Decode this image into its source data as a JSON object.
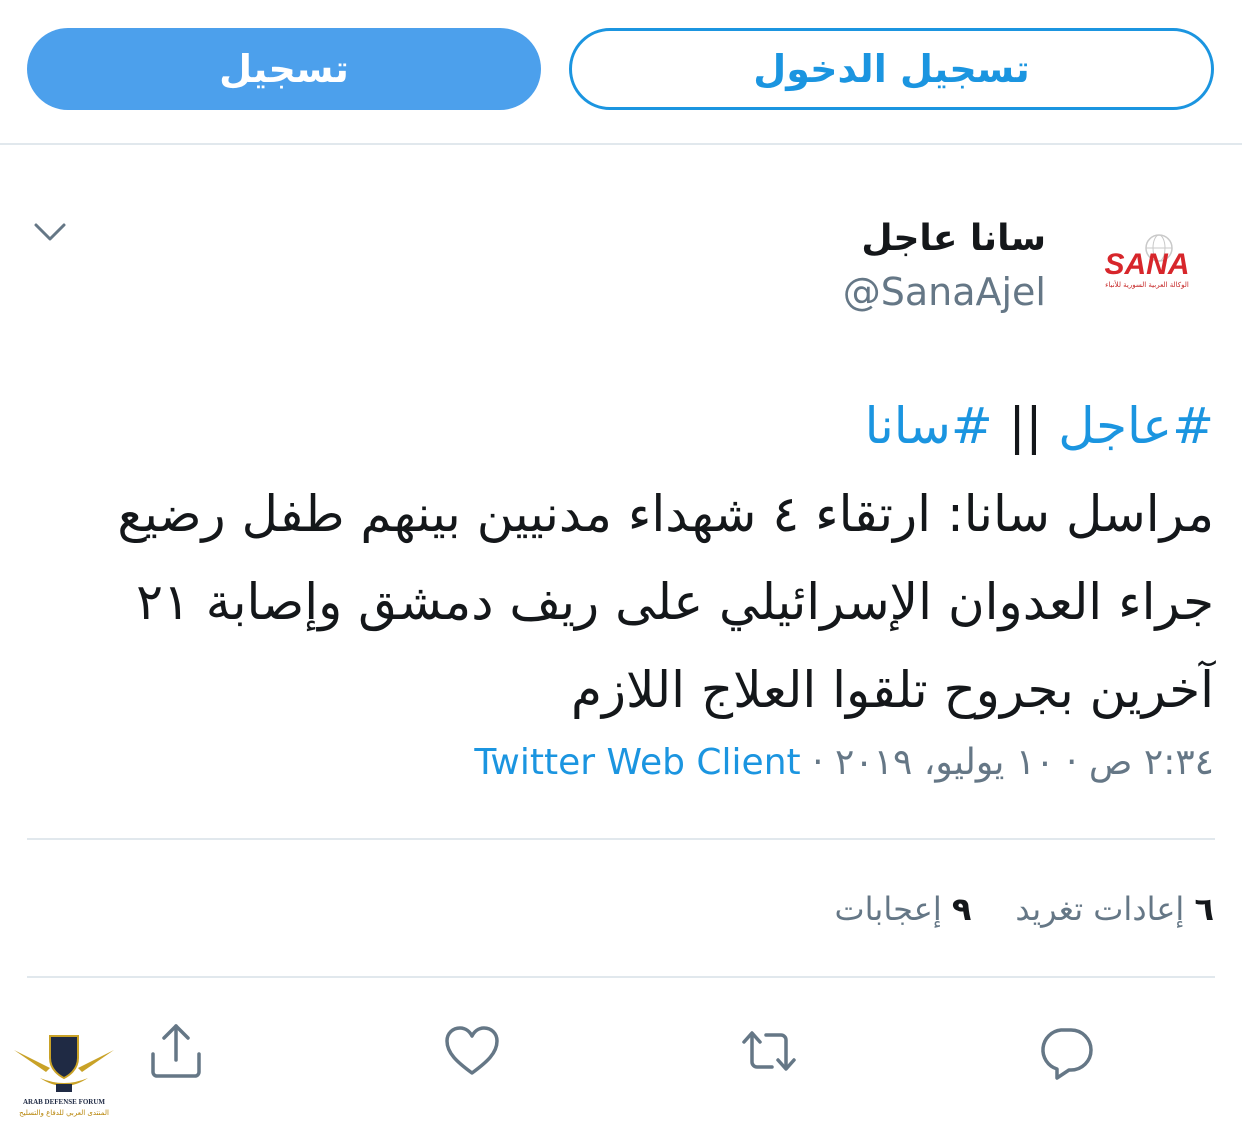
{
  "auth": {
    "signup_label": "تسجيل",
    "login_label": "تسجيل الدخول"
  },
  "tweet": {
    "display_name": "سانا عاجل",
    "handle": "@SanaAjel",
    "avatar_text": "SANA",
    "avatar_subtext": "الوكالة العربية السورية للأنباء",
    "hashtag_1": "#عاجل",
    "separator": " || ",
    "hashtag_2": "#سانا",
    "body": "مراسل سانا: ارتقاء ٤ شهداء مدنيين بينهم طفل رضيع جراء العدوان الإسرائيلي على ريف دمشق وإصابة ٢١ آخرين بجروح تلقوا العلاج اللازم",
    "timestamp": "٢:٣٤ ص · ١٠ يوليو، ٢٠١٩ · ",
    "client": "Twitter Web Client"
  },
  "stats": {
    "retweets_count": "٦",
    "retweets_label": "إعادات تغريد",
    "likes_count": "٩",
    "likes_label": "إعجابات"
  },
  "watermark": {
    "line1": "ARAB DEFENSE FORUM",
    "line2": "المنتدى العربي للدفاع والتسليح"
  },
  "colors": {
    "accent": "#1b95e0",
    "signup_bg": "#4ca0ec",
    "muted": "#657786",
    "divider": "#e1e8ed",
    "sana_red": "#d7262b"
  }
}
